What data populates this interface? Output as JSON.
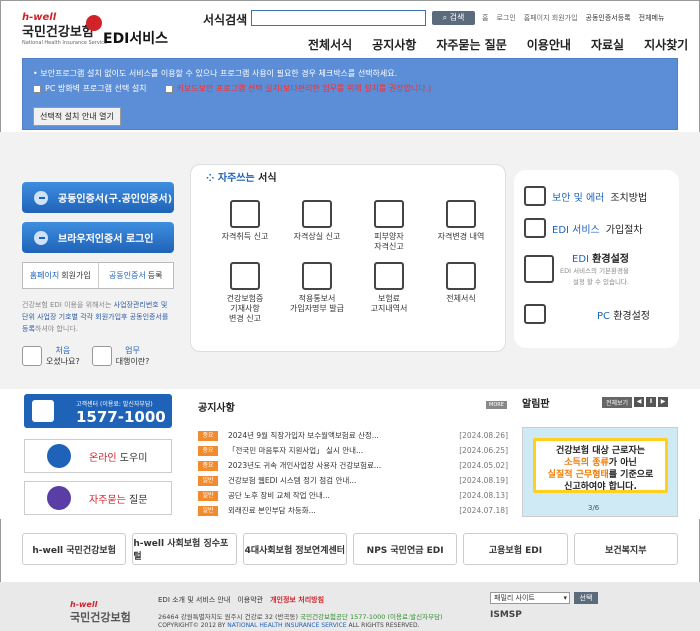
{
  "header": {
    "logo_hwell": "h-well",
    "logo_name": "국민건강보험",
    "logo_sub": "National Health Insurance Service",
    "service": "EDI서비스",
    "search_label": "서식검색",
    "search_button": "검색",
    "top_links": [
      "홈",
      "로그인",
      "홈페이지 회원가입",
      "공동인증서등록",
      "전체메뉴"
    ],
    "nav": [
      "전체서식",
      "공지사항",
      "자주묻는 질문",
      "이용안내",
      "자료실",
      "지사찾기"
    ]
  },
  "notice": {
    "line1": "• 보안프로그램 설치 없이도 서비스를 이용할 수 있으나 프로그램 사용이 필요한 경우 체크박스를 선택하세요.",
    "opt1": "PC 방화벽 프로그램 선택 설치",
    "opt2": "키보드보안 프로그램 선택 설치(보다편리한 업무를 위해 설치를 권장합니다.)",
    "guide_button": "선택적 설치 안내 열기"
  },
  "left": {
    "cert_login": "공동인증서(구.공인인증서)",
    "browser_login": "브라우저인증서 로그인",
    "reg1_a": "홈페이지",
    "reg1_b": "회원가입",
    "reg2_a": "공동인증서",
    "reg2_b": "등록",
    "desc_a": "건강보험 EDI 이용을 위해서는 ",
    "desc_b": "사업장관리번호 및 단위 사업장 기호별 각각 회원가입후 공동인증서를 등록",
    "desc_c": "하셔야 합니다.",
    "q1_a": "처음",
    "q1_b": "오셨나요?",
    "q2_a": "업무",
    "q2_b": "대행이란?"
  },
  "forms": {
    "title_a": "자주쓰는",
    "title_b": "서식",
    "items": [
      "자격취득 신고",
      "자격상실 신고",
      "피부양자\n자격신고",
      "자격변경 내역",
      "건강보험증\n기재사항\n변경 신고",
      "적용통보서\n가입자명부 발급",
      "보험료\n고지내역서",
      "전체서식"
    ]
  },
  "right": {
    "r1_a": "보안 및 에러",
    "r1_b": "조치방법",
    "r2_a": "EDI 서비스",
    "r2_b": "가입절차",
    "r3_a": "EDI",
    "r3_b": "환경설정",
    "r3_sub": "EDI 서비스의 기본환경을\n설정 할 수 있습니다.",
    "r4_a": "PC",
    "r4_b": "환경설정"
  },
  "callcenter": {
    "label": "고객센터 (이용료: 발신자부담)",
    "number": "1577-1000"
  },
  "online_a": "온라인",
  "online_b": "도우미",
  "faq_a": "자주묻는",
  "faq_b": "질문",
  "board": {
    "title": "공지사항",
    "more": "MORE",
    "items": [
      {
        "tag": "중요",
        "title": "2024년 9월 직장가입자 보수월액보험료 산정...",
        "date": "[2024.08.26]"
      },
      {
        "tag": "중요",
        "title": "「전국민 마음투자 지원사업」 실시 안내...",
        "date": "[2024.06.25]"
      },
      {
        "tag": "중요",
        "title": "2023년도 귀속 개인사업장 사용자 건강보험료...",
        "date": "[2024.05.02]"
      },
      {
        "tag": "일반",
        "title": "건강보험 웹EDI 시스템 정기 점검 안내...",
        "date": "[2024.08.19]"
      },
      {
        "tag": "일반",
        "title": "공단 노후 장비 교체 작업 안내...",
        "date": "[2024.08.13]"
      },
      {
        "tag": "일반",
        "title": "외래진료 본인부담 차등화...",
        "date": "[2024.07.18]"
      }
    ]
  },
  "alarm": {
    "title": "알림판",
    "view_all": "전체보기",
    "l1": "건강보험 대상 근로자는",
    "l2a": "소득의 종류",
    "l2b": "가 아닌",
    "l3a": "실질적 근무형태",
    "l3b": "를 기준으로",
    "l4": "신고하여야 합니다.",
    "page": "3/6"
  },
  "banners": [
    "h-well 국민건강보험",
    "h-well 사회보험 징수포털",
    "4대사회보험 정보연계센터",
    "NPS 국민연금 EDI",
    "고용보험 EDI",
    "보건복지부"
  ],
  "footer": {
    "hwell": "h-well",
    "name": "국민건강보험",
    "links": [
      "EDI 소개 및 서비스 안내",
      "이용약관",
      "개인정보 처리방침"
    ],
    "address": "26464 강원특별자치도 원주시 건강로 32 (반곡동)",
    "address_g": "국민건강보험공단 1577-1000 (이용료:발신자부담)",
    "copy_a": "COPYRIGHT© 2012 BY ",
    "copy_b": "NATIONAL HEALTH INSURANCE SERVICE",
    "copy_c": " ALL RIGHTS RESERVED.",
    "family": "패밀리 사이트",
    "select": "선택",
    "ismsp": "ISMSP"
  }
}
